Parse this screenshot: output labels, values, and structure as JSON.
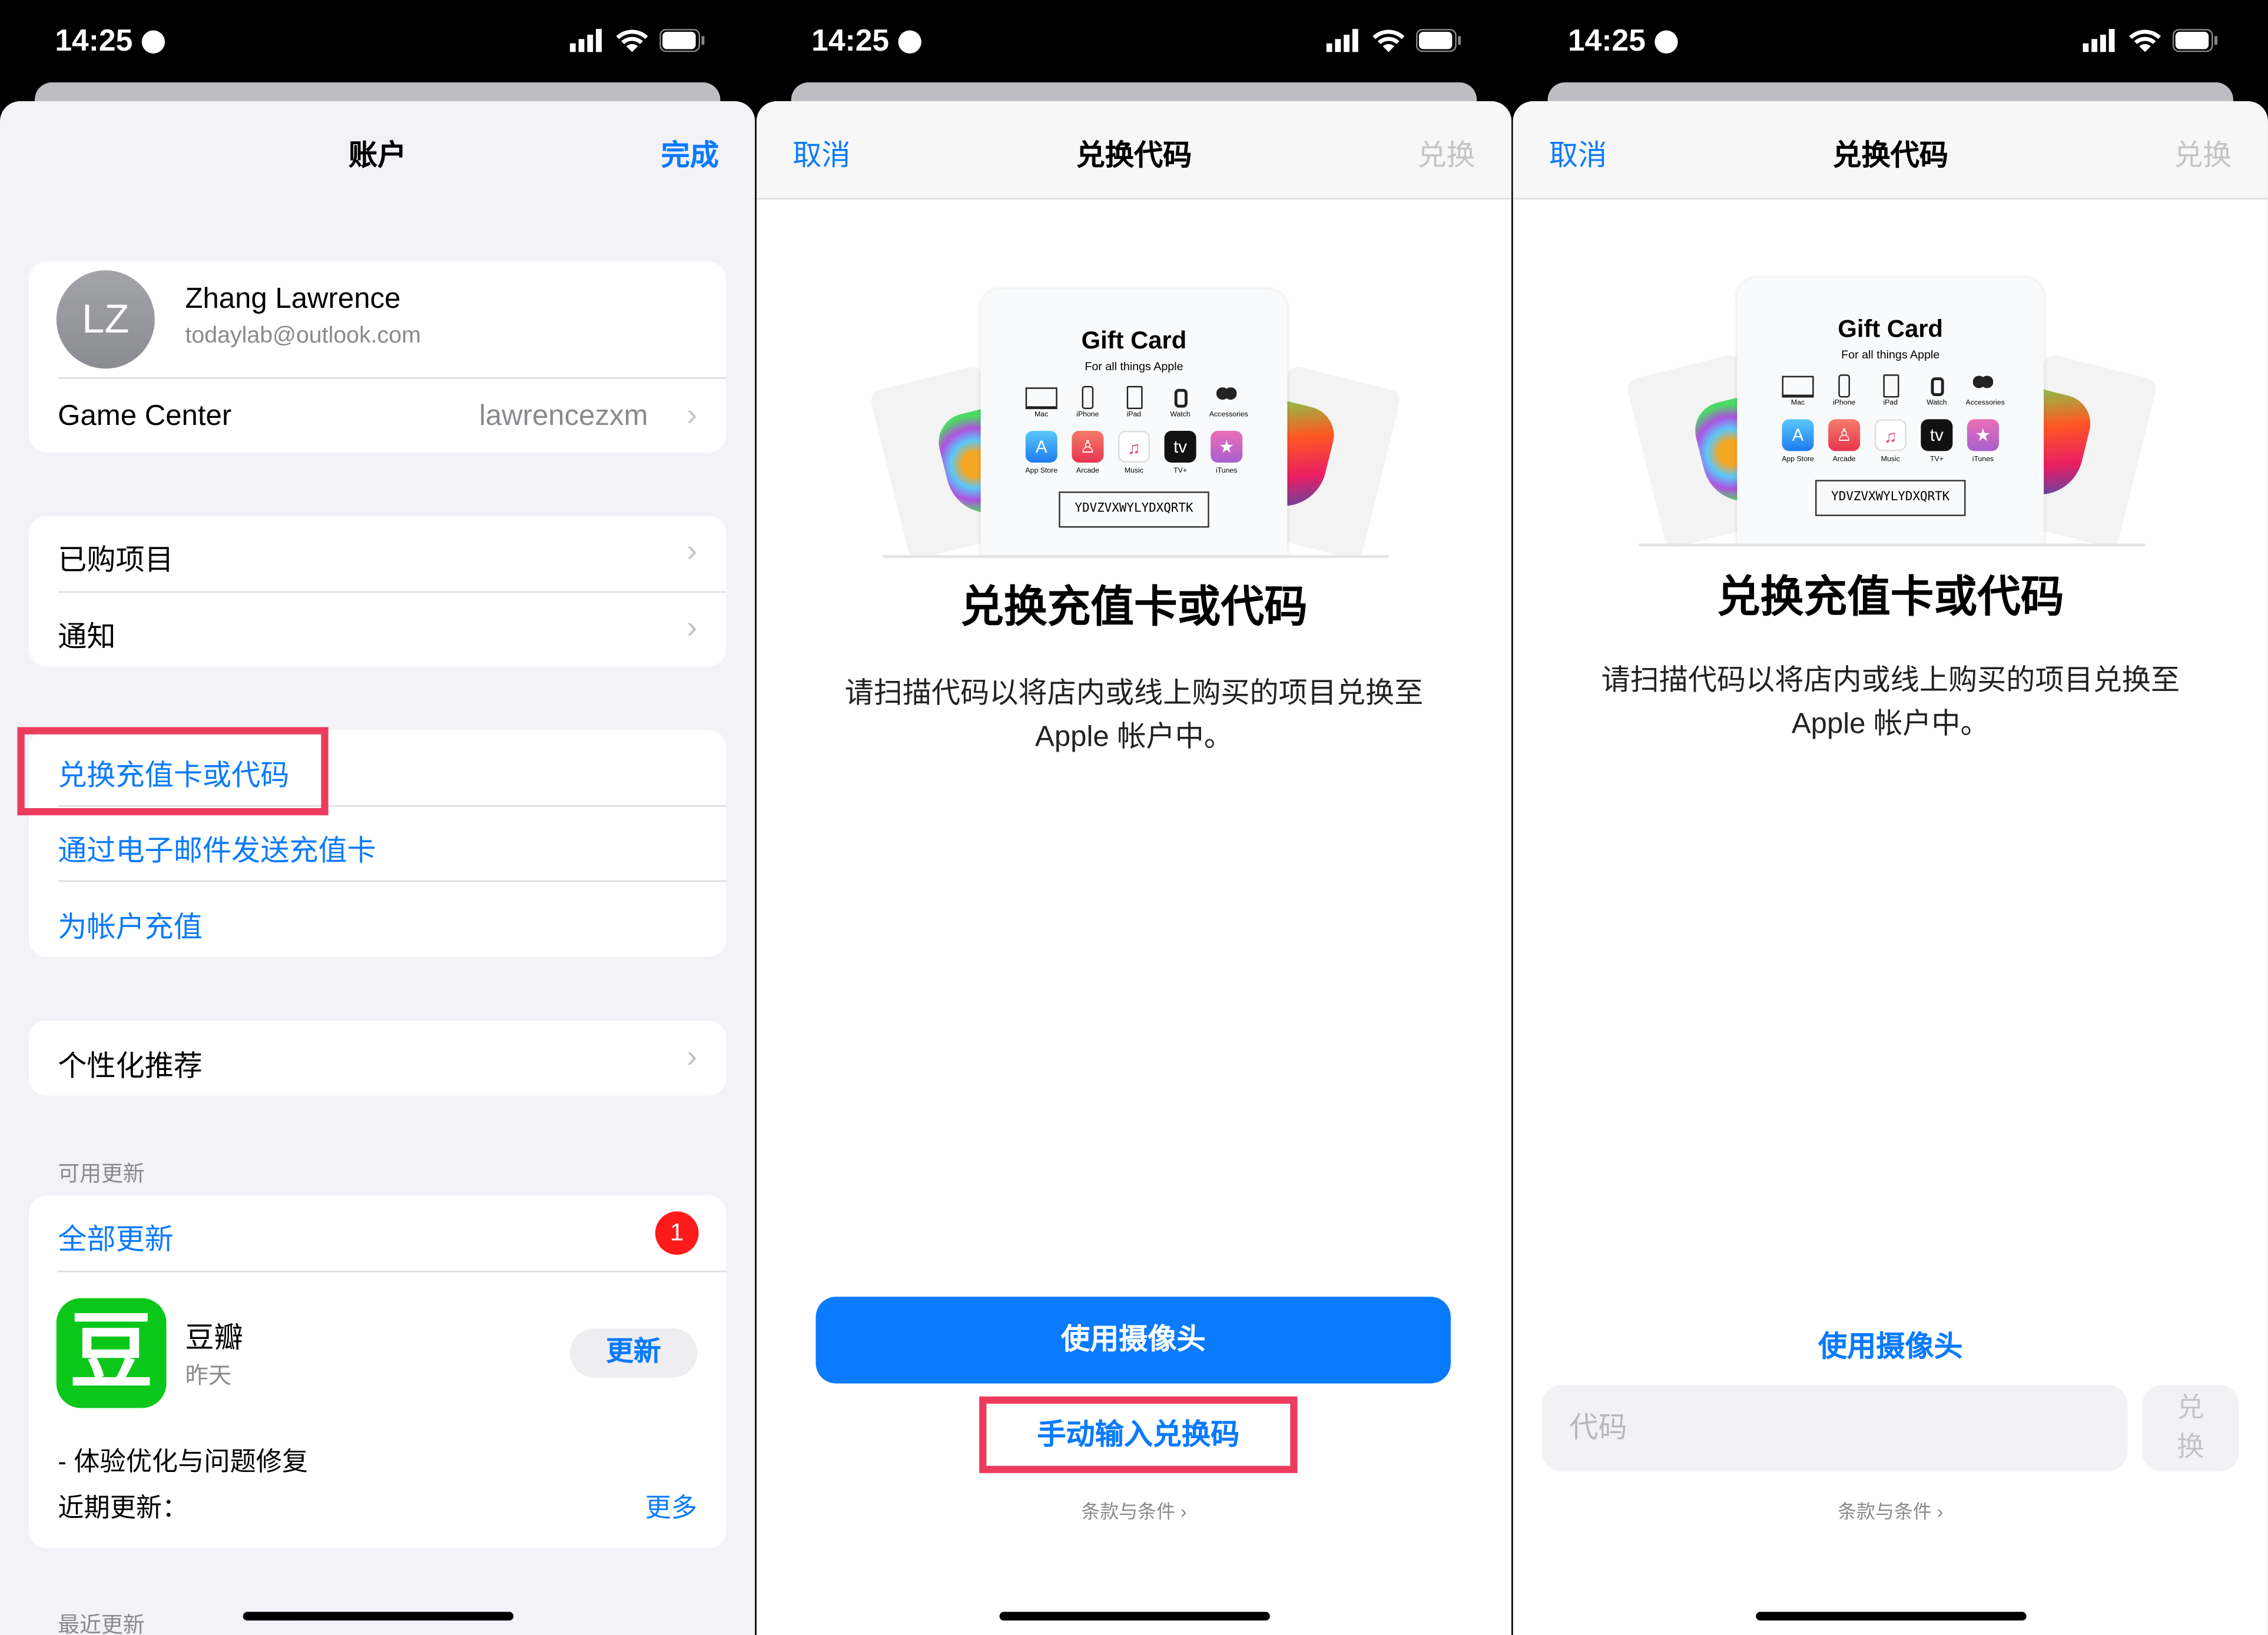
{
  "status": {
    "time": "14:25"
  },
  "account": {
    "title": "账户",
    "done": "完成",
    "profile": {
      "initials": "LZ",
      "name": "Zhang Lawrence",
      "email": "todaylab@outlook.com"
    },
    "game_center": {
      "label": "Game Center",
      "value": "lawrencezxm"
    },
    "group2": [
      "已购项目",
      "通知"
    ],
    "group3": [
      "兑换充值卡或代码",
      "通过电子邮件发送充值卡",
      "为帐户充值"
    ],
    "personalized": "个性化推荐",
    "updates_header": "可用更新",
    "update_all": "全部更新",
    "badge": "1",
    "app": {
      "name": "豆瓣",
      "date": "昨天",
      "button": "更新",
      "notes": "- 体验优化与问题修复",
      "recent": "近期更新：",
      "more": "更多",
      "icon_glyph": "豆"
    },
    "recent_header": "最近更新"
  },
  "redeem": {
    "cancel": "取消",
    "title": "兑换代码",
    "redeem": "兑换",
    "gift": {
      "brand": "Gift Card",
      "tagline": "For all things Apple",
      "code": "YDVZVXWYLYDXQRTK",
      "devices": [
        "Mac",
        "iPhone",
        "iPad",
        "Watch",
        "Accessories"
      ],
      "services": [
        "App Store",
        "Arcade",
        "Music",
        "TV+",
        "iTunes"
      ]
    },
    "heading": "兑换充值卡或代码",
    "desc1": "请扫描代码以将店内或线上购买的项目兑换至",
    "desc2": "Apple 帐户中。",
    "camera": "使用摄像头",
    "manual": "手动输入兑换码",
    "terms": "条款与条件 ›",
    "code_placeholder": "代码",
    "redeem_btn1": "兑",
    "redeem_btn2": "换"
  },
  "colors": {
    "accent": "#0a7aff",
    "highlight": "#ec3b5c",
    "badge": "#ff1a1a",
    "douban": "#0ac71a"
  }
}
